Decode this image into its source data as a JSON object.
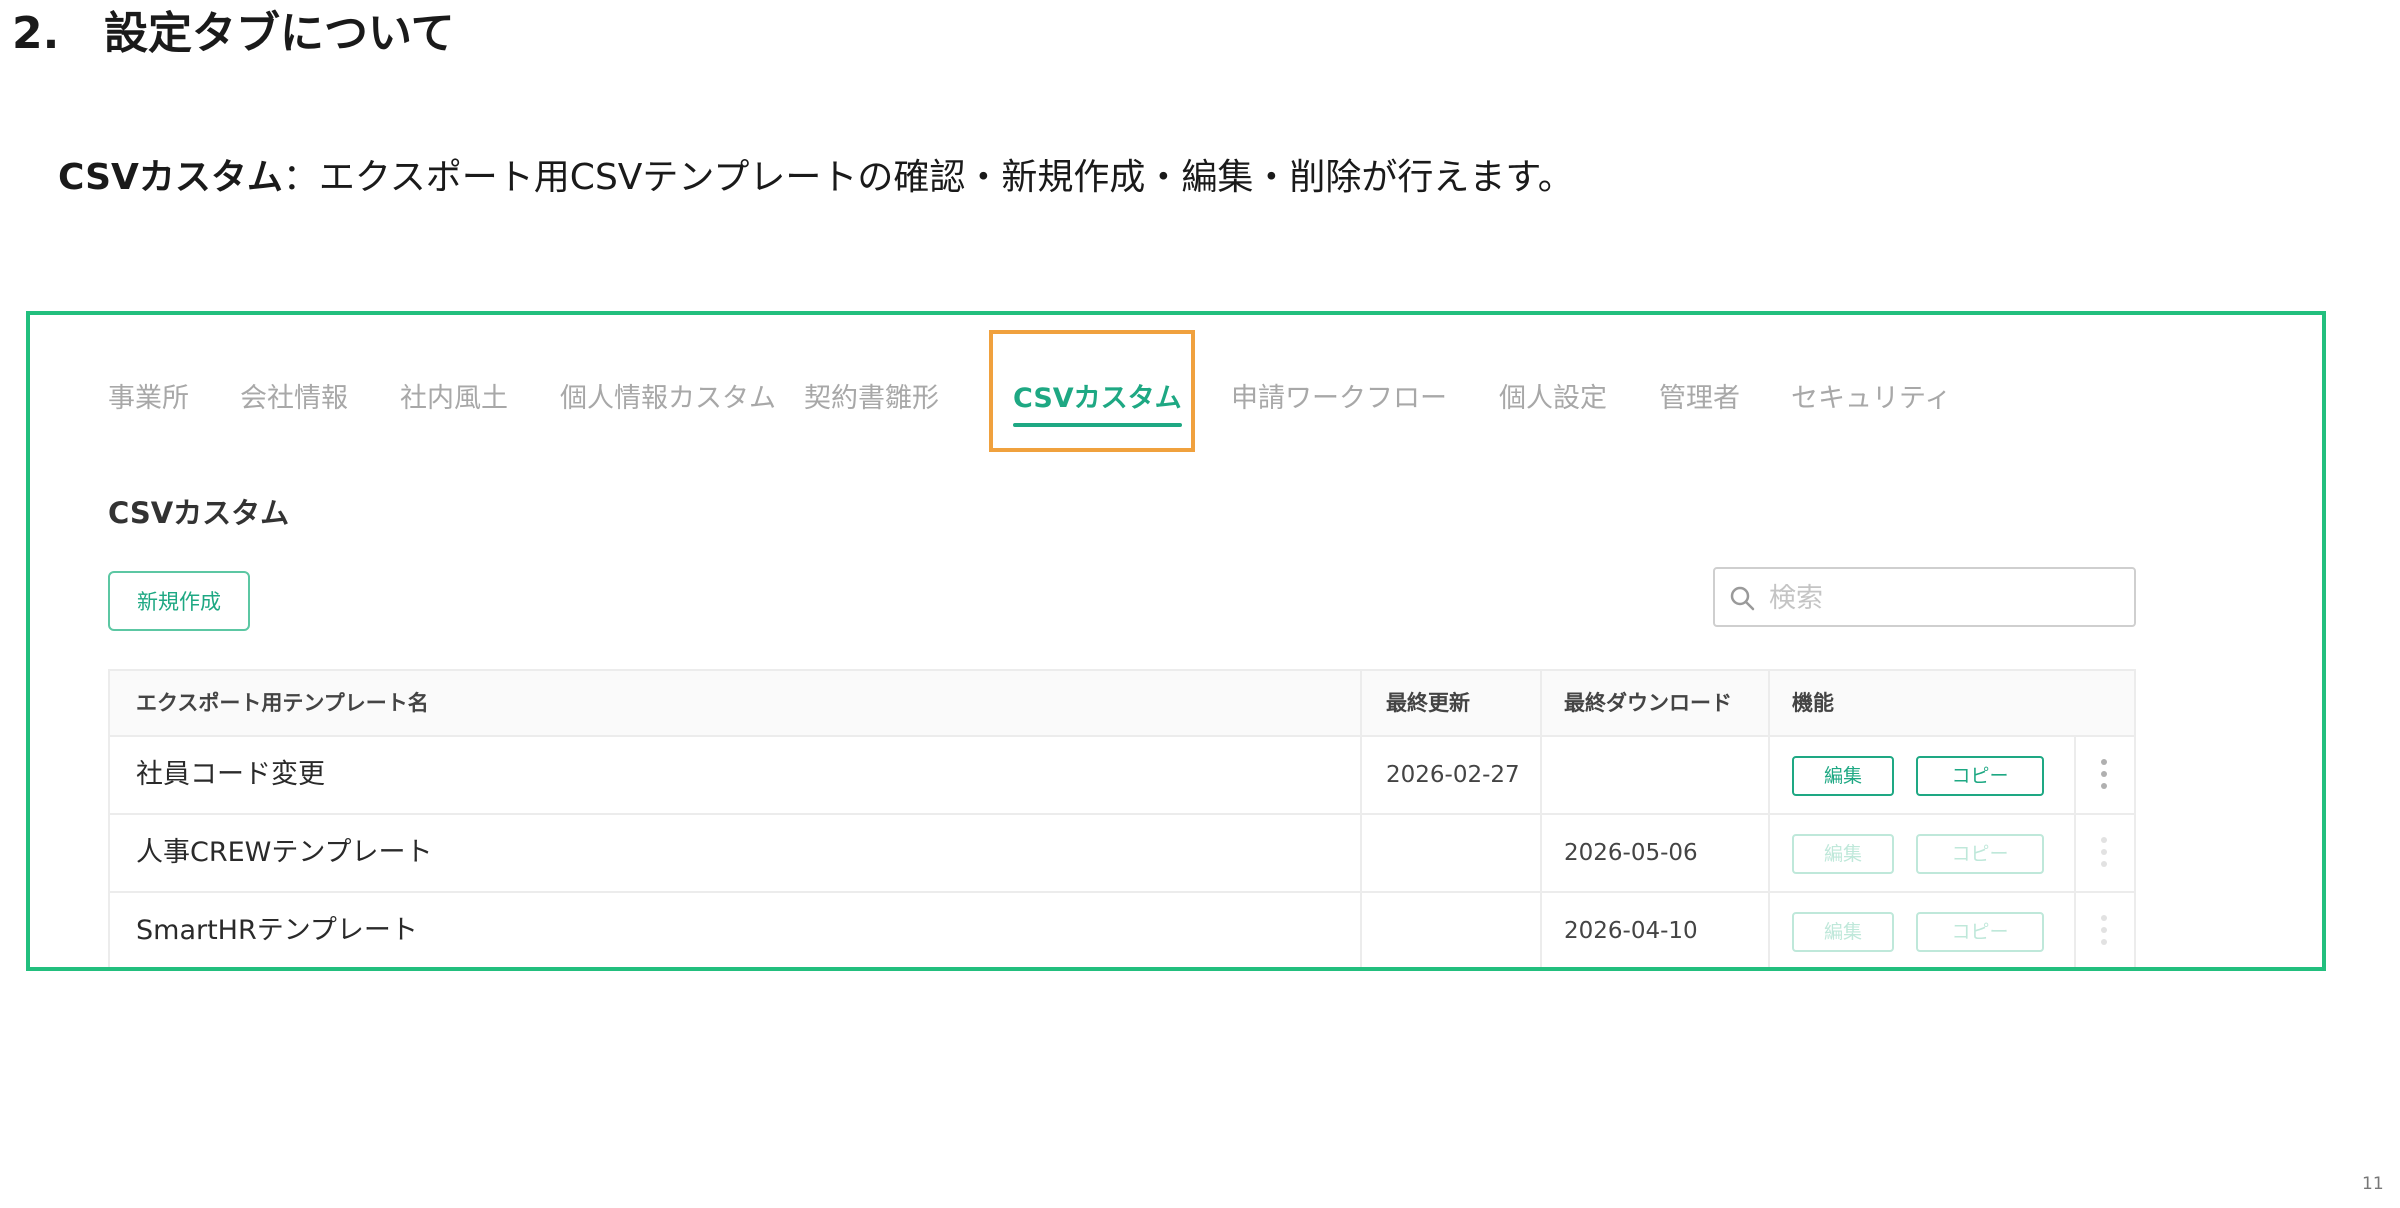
{
  "heading": {
    "number": "2.",
    "title": "設定タブについて"
  },
  "intro": {
    "term": "CSVカスタム",
    "description": "：エクスポート用CSVテンプレートの確認・新規作成・編集・削除が行えます。"
  },
  "tabs": [
    {
      "label": "事業所",
      "active": false
    },
    {
      "label": "会社情報",
      "active": false
    },
    {
      "label": "社内風土",
      "active": false
    },
    {
      "label": "個人情報カスタム",
      "active": false
    },
    {
      "label": "契約書雛形",
      "active": false
    },
    {
      "label": "CSVカスタム",
      "active": true
    },
    {
      "label": "申請ワークフロー",
      "active": false
    },
    {
      "label": "個人設定",
      "active": false
    },
    {
      "label": "管理者",
      "active": false
    },
    {
      "label": "セキュリティ",
      "active": false
    }
  ],
  "section": {
    "title": "CSVカスタム",
    "new_button": "新規作成",
    "search_placeholder": "検索"
  },
  "table": {
    "columns": [
      "エクスポート用テンプレート名",
      "最終更新",
      "最終ダウンロード",
      "機能"
    ],
    "rows": [
      {
        "name": "社員コード変更",
        "updated": "2026-02-27",
        "downloaded": "",
        "edit": "編集",
        "copy": "コピー",
        "enabled": true
      },
      {
        "name": "人事CREWテンプレート",
        "updated": "",
        "downloaded": "2026-05-06",
        "edit": "編集",
        "copy": "コピー",
        "enabled": false
      },
      {
        "name": "SmartHRテンプレート",
        "updated": "",
        "downloaded": "2026-04-10",
        "edit": "編集",
        "copy": "コピー",
        "enabled": false
      }
    ]
  },
  "colors": {
    "frame": "#22bf7e",
    "accent": "#1ea883",
    "tab_highlight": "#f0a13e"
  },
  "icons": {
    "search": "search-icon",
    "more": "kebab-icon"
  },
  "page_number": "11"
}
